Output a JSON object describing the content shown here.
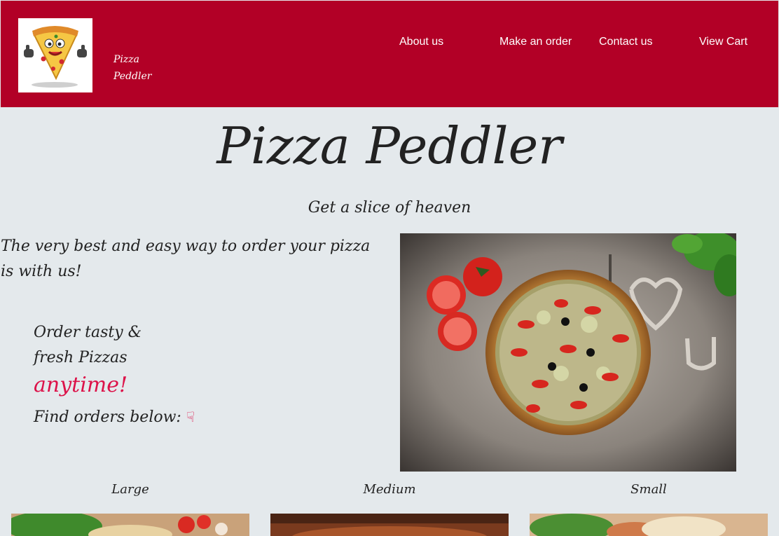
{
  "brand": {
    "name_line1": "Pizza",
    "name_line2": "Peddler"
  },
  "nav": {
    "about": "About us",
    "order": "Make an order",
    "contact": "Contact us",
    "cart": "View Cart"
  },
  "hero": {
    "title": "Pizza Peddler",
    "subtitle": "Get a slice of heaven"
  },
  "intro": {
    "text": "The very best and easy way to order your pizza is with us!",
    "order_line1": "Order tasty &",
    "order_line2": "fresh Pizzas",
    "highlight": "anytime!",
    "find": "Find orders below:",
    "hand_icon": "☟"
  },
  "sizes": [
    {
      "label": "Large"
    },
    {
      "label": "Medium"
    },
    {
      "label": "Small"
    }
  ],
  "colors": {
    "accent": "#b20026",
    "highlight": "#dc1249",
    "background": "#e4e9ec"
  }
}
